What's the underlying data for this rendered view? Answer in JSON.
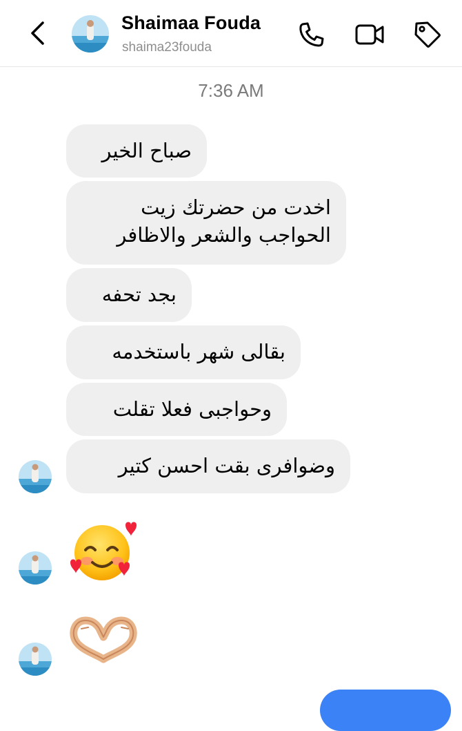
{
  "header": {
    "name": "Shaimaa Fouda",
    "username": "shaima23fouda",
    "icons": [
      "back-arrow-icon",
      "phone-icon",
      "video-camera-icon",
      "tag-icon"
    ]
  },
  "timestamp": "7:36 AM",
  "messages": [
    {
      "text": "صباح الخير"
    },
    {
      "text": "اخدت من حضرتك زيت\nالحواجب والشعر والاظافر"
    },
    {
      "text": "بجد تحفه"
    },
    {
      "text": "بقالى شهر باستخدمه"
    },
    {
      "text": "وحواجبى فعلا تقلت"
    },
    {
      "text": "وضوافرى بقت احسن كتير"
    }
  ],
  "reactions": [
    "smiling-face-with-hearts-emoji",
    "heart-hands-emoji"
  ],
  "colors": {
    "bubble": "#efefef",
    "secondary_text": "#8e8e8e",
    "accent": "#3b82f6"
  }
}
